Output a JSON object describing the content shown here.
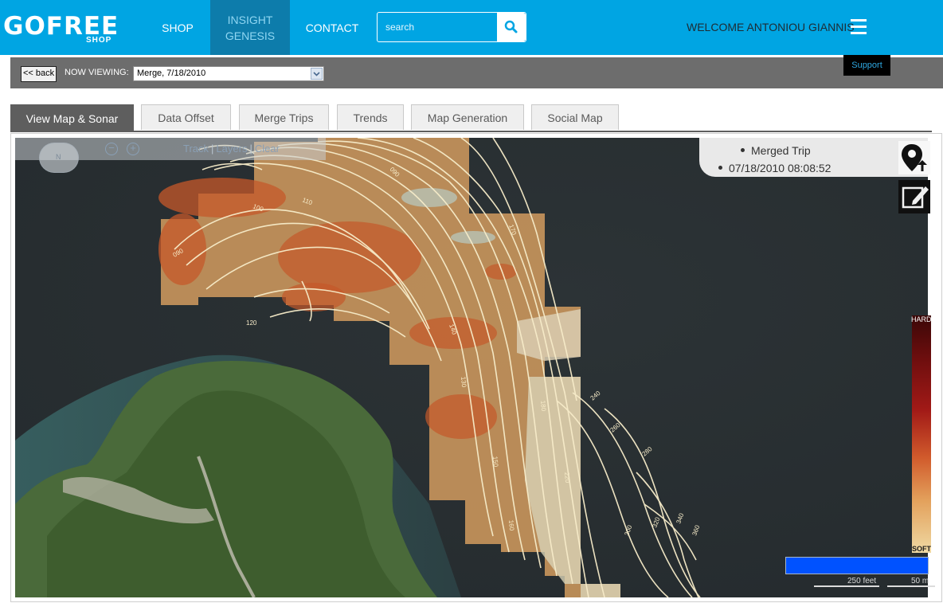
{
  "nav": {
    "logo_text": "GOFREE",
    "logo_sub": "SHOP",
    "shop": "SHOP",
    "insight_line1": "INSIGHT",
    "insight_line2": "GENESIS",
    "contact": "CONTACT",
    "search_placeholder": "search",
    "welcome": "WELCOME ANTONIOU GIANNIS",
    "brand_color": "#00a5e3"
  },
  "viewbar": {
    "back_label": "<< back",
    "now_viewing_label": "NOW VIEWING:",
    "selected_trip": "Merge, 7/18/2010",
    "support_label": "Support"
  },
  "tabs": [
    {
      "label": "View Map & Sonar",
      "active": true
    },
    {
      "label": "Data Offset",
      "active": false
    },
    {
      "label": "Merge Trips",
      "active": false
    },
    {
      "label": "Trends",
      "active": false
    },
    {
      "label": "Map Generation",
      "active": false
    },
    {
      "label": "Social Map",
      "active": false
    }
  ],
  "map": {
    "compass_label": "N",
    "toolbar": {
      "track": "Track",
      "layers": "Layers",
      "clear": "Clear",
      "separator": "|"
    },
    "info": {
      "title": "Merged Trip",
      "datetime": "07/18/2010 08:08:52"
    },
    "legend": {
      "hard": "HARD",
      "soft": "SOFT"
    },
    "scale": {
      "feet": "250 feet",
      "meters": "50 m"
    },
    "contour_labels": [
      "090",
      "100",
      "110",
      "120",
      "130",
      "140",
      "150",
      "160",
      "170",
      "180",
      "200",
      "220",
      "240",
      "260",
      "280",
      "300",
      "320",
      "340",
      "360"
    ]
  }
}
